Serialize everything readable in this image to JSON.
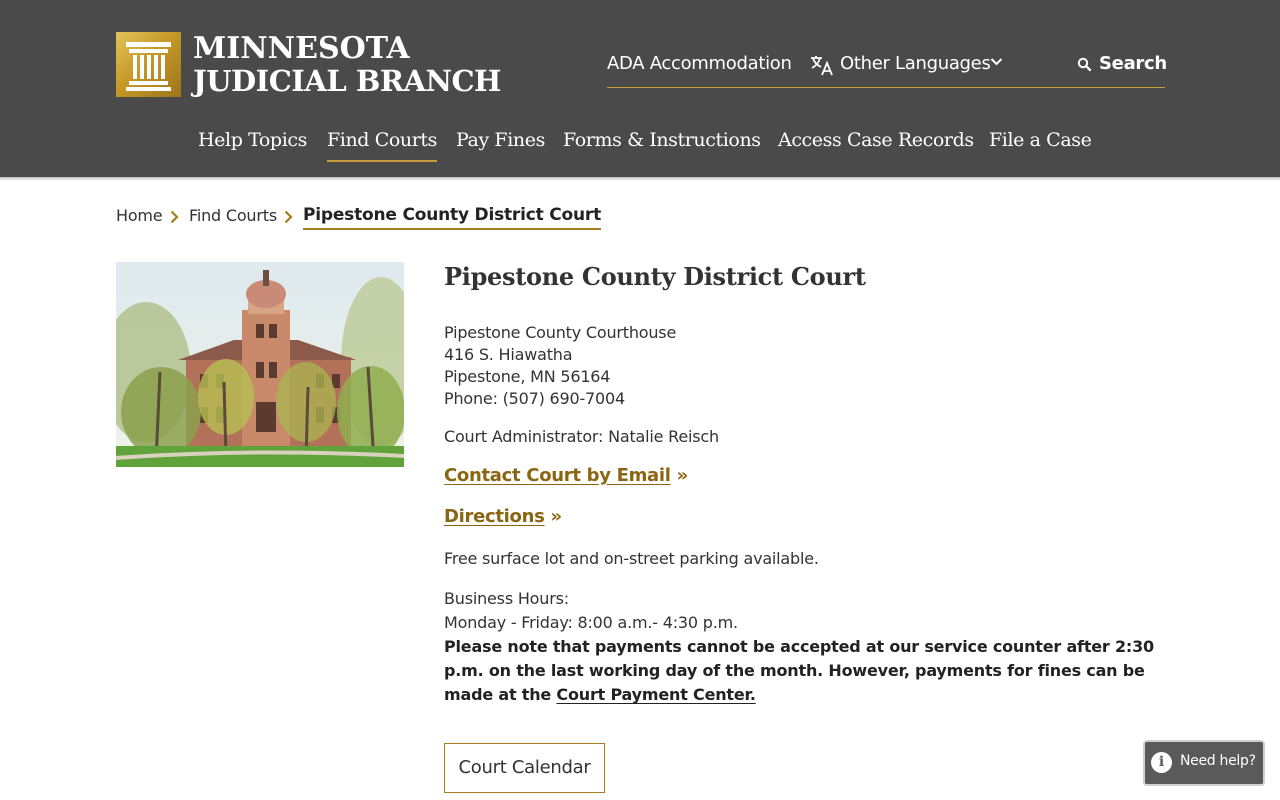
{
  "header": {
    "logo": {
      "line1": "MINNESOTA",
      "line2": "JUDICIAL BRANCH",
      "icon": "column-pillar-icon"
    },
    "utility": {
      "ada": "ADA Accommodation",
      "languages": "Other Languages",
      "search": "Search"
    },
    "nav": [
      {
        "label": "Help Topics",
        "active": false
      },
      {
        "label": "Find Courts",
        "active": true
      },
      {
        "label": "Pay Fines",
        "active": false
      },
      {
        "label": "Forms & Instructions",
        "active": false
      },
      {
        "label": "Access Case Records",
        "active": false
      },
      {
        "label": "File a Case",
        "active": false
      }
    ]
  },
  "breadcrumb": {
    "home": "Home",
    "find_courts": "Find Courts",
    "current": "Pipestone County District Court"
  },
  "photo": {
    "subject": "courthouse-photo"
  },
  "court": {
    "title": "Pipestone County District Court",
    "address": {
      "building": "Pipestone County Courthouse",
      "street": "416 S. Hiawatha",
      "city": "Pipestone, MN 56164",
      "phone": "Phone: (507) 690-7004"
    },
    "administrator": "Court Administrator: Natalie Reisch",
    "contact_link": "Contact Court by Email",
    "directions_link": "Directions",
    "link_suffix": "»",
    "parking": "Free surface lot and on-street parking available.",
    "hours_label": "Business Hours:",
    "hours": "Monday - Friday: 8:00 a.m.- 4:30 p.m.",
    "note": "Please note that payments cannot be accepted at our service counter after 2:30 p.m. on the last working day of the month.  However, payments for fines can be made at the ",
    "note_link": "Court Payment Center.",
    "calendar_button": "Court Calendar"
  },
  "help": {
    "label": "Need help?",
    "icon": "info-icon"
  },
  "colors": {
    "header_bg": "#4a4a4a",
    "accent_gold": "#c89b3c",
    "link_gold": "#8a6512"
  }
}
